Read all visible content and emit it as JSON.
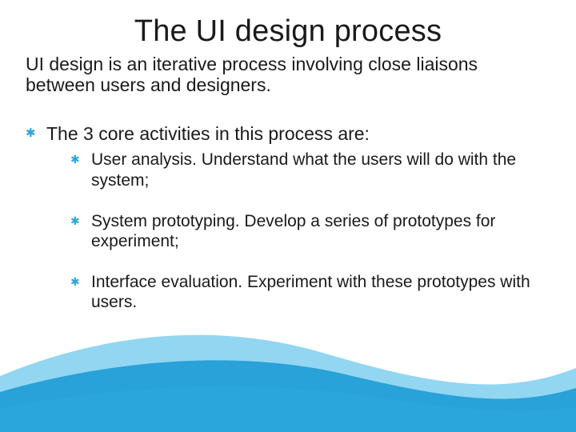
{
  "title": "The UI design process",
  "intro": "UI design is an iterative process involving close liaisons between users and designers.",
  "bullet1": "The 3 core activities in this process are:",
  "sub1": "User analysis. Understand what the users will do with the system;",
  "sub2": "System prototyping. Develop a series of prototypes for experiment;",
  "sub3": "Interface evaluation. Experiment with these prototypes with users.",
  "colors": {
    "accent": "#2aa6dd",
    "wave_light": "#6ec8ec",
    "wave_dark": "#1e9bd6"
  }
}
